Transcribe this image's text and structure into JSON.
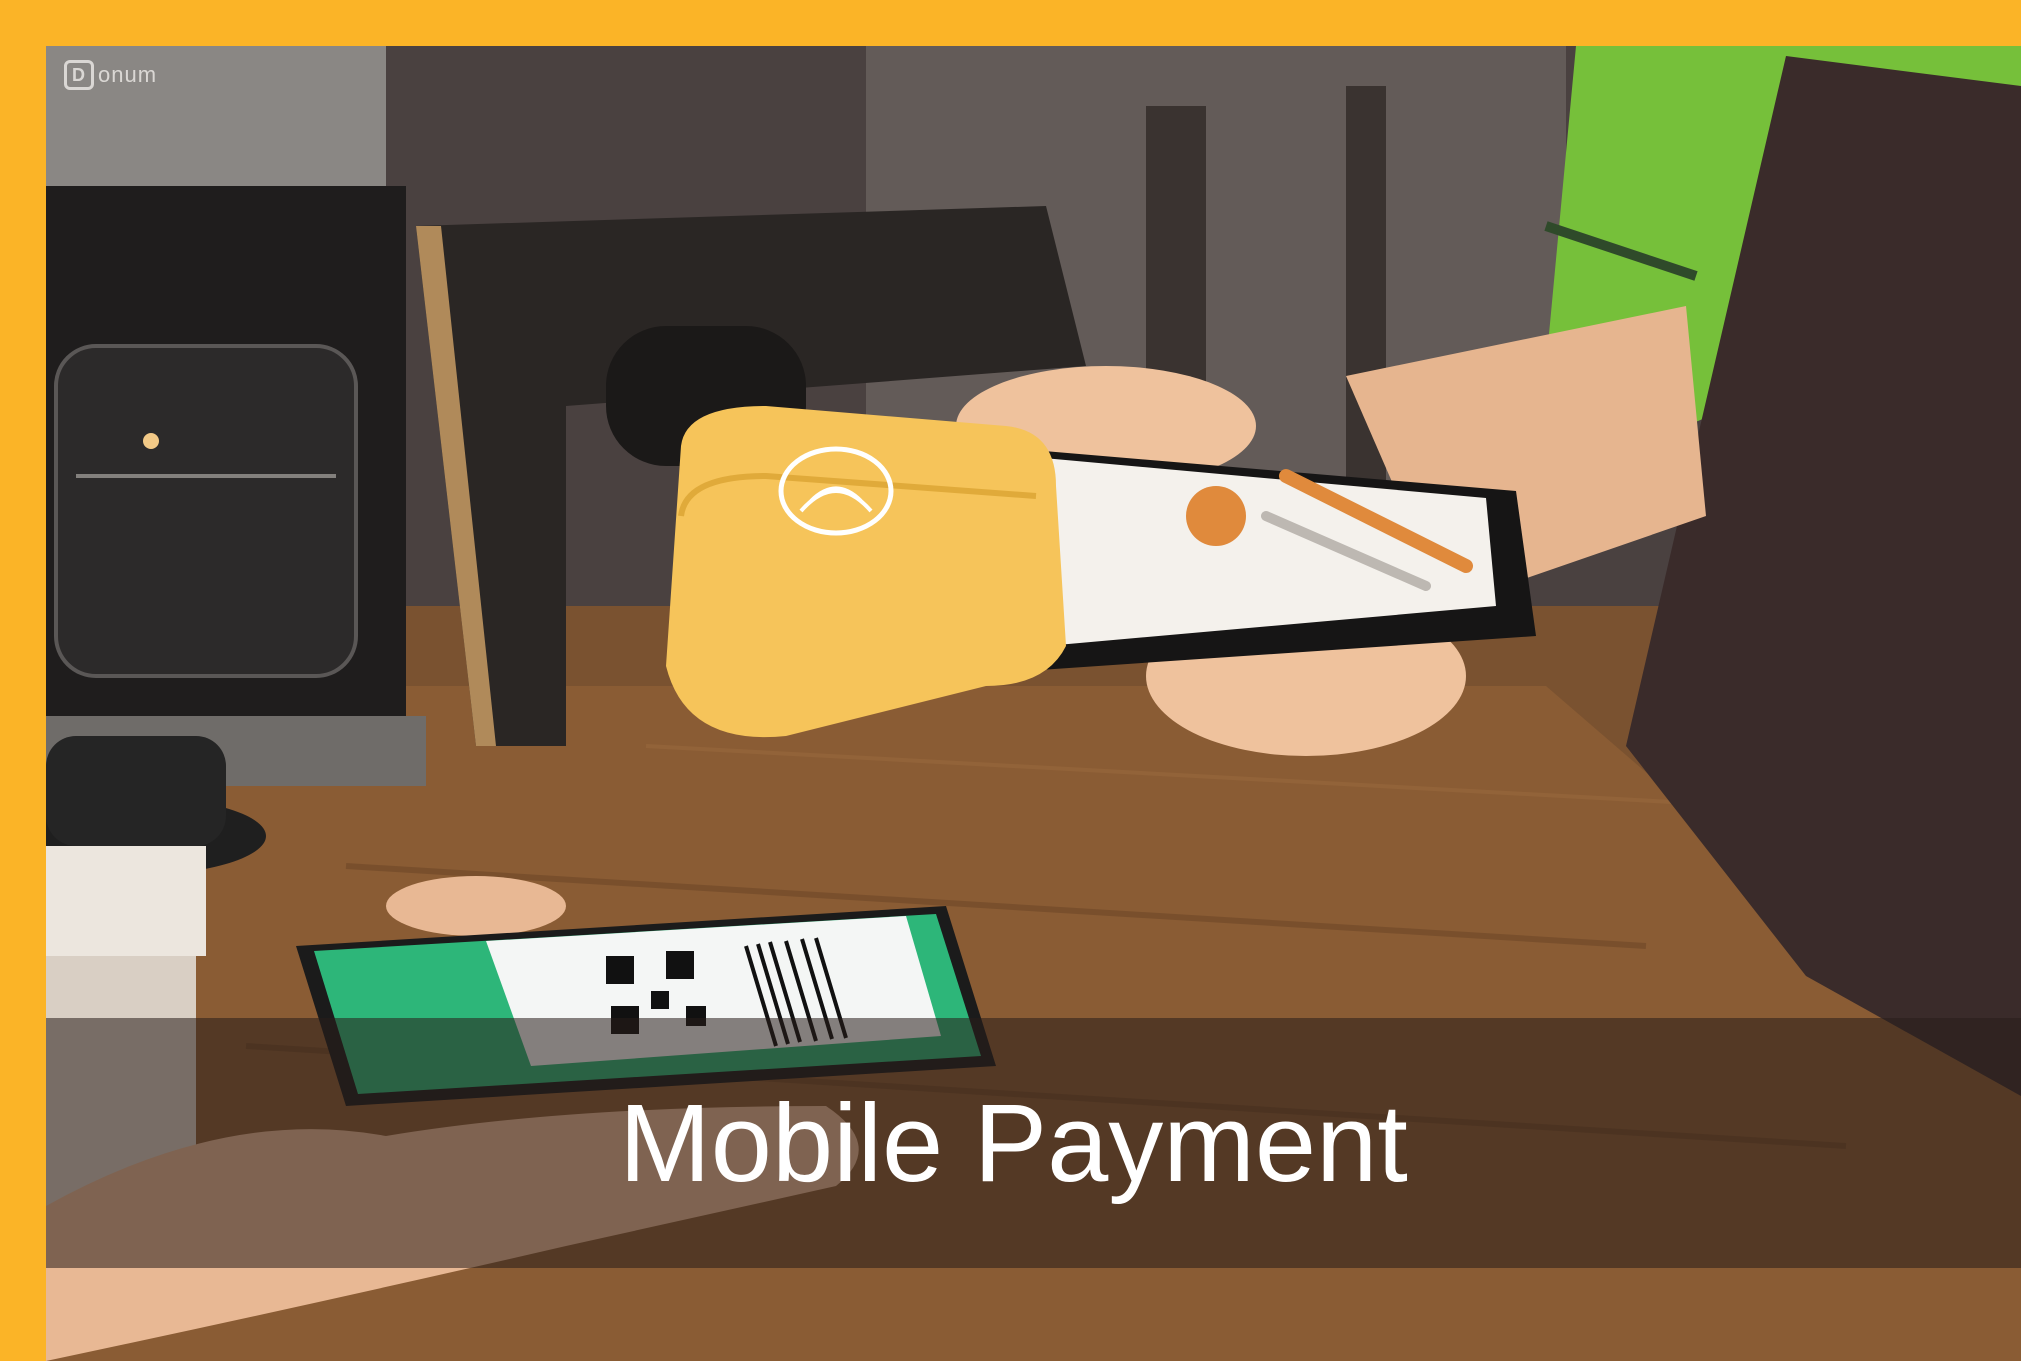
{
  "brand": {
    "name": "onum",
    "mark": "D"
  },
  "caption": "Mobile Payment",
  "colors": {
    "frame": "#FBB427",
    "printer_yellow": "#F6C45A",
    "app_green": "#2DB679",
    "app_orange": "#E08A3C",
    "shirt_green": "#76C03A"
  },
  "scene": {
    "left_foreground": "coffee-cup-icon",
    "background": "coffee-maker-icon",
    "merchant_device": "pos-terminal-icon",
    "customer_device": "smartphone-qr-icon",
    "payment_symbol": "contactless-icon"
  }
}
